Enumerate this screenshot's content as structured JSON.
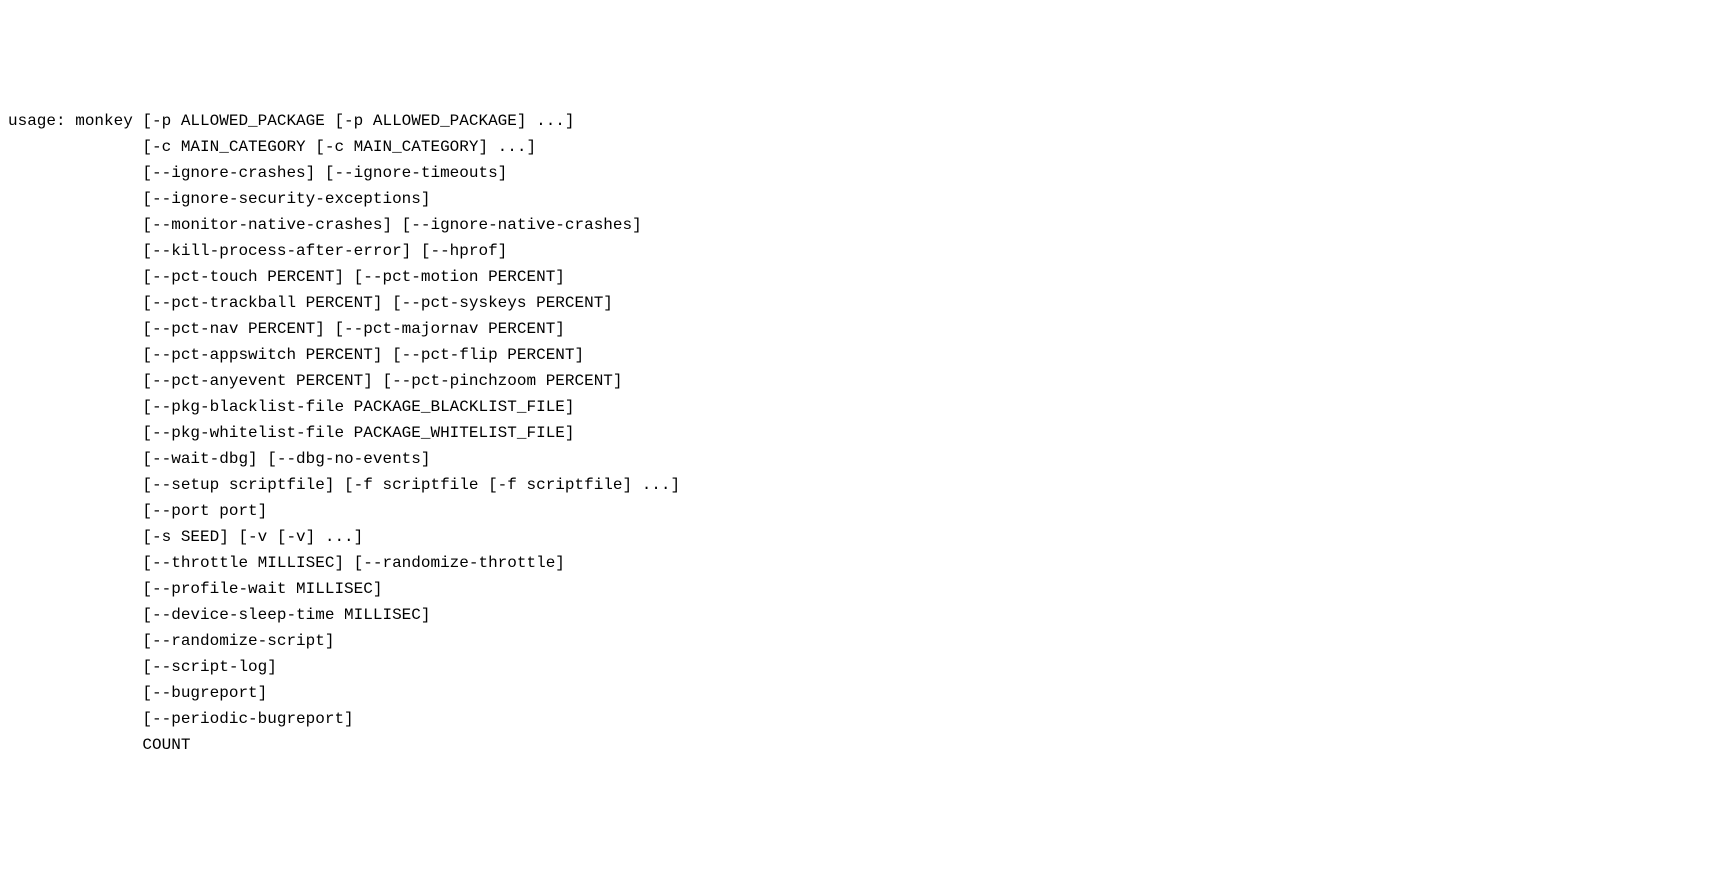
{
  "usage": {
    "lines": [
      "usage: monkey [-p ALLOWED_PACKAGE [-p ALLOWED_PACKAGE] ...]",
      "              [-c MAIN_CATEGORY [-c MAIN_CATEGORY] ...]",
      "              [--ignore-crashes] [--ignore-timeouts]",
      "              [--ignore-security-exceptions]",
      "              [--monitor-native-crashes] [--ignore-native-crashes]",
      "              [--kill-process-after-error] [--hprof]",
      "              [--pct-touch PERCENT] [--pct-motion PERCENT]",
      "              [--pct-trackball PERCENT] [--pct-syskeys PERCENT]",
      "              [--pct-nav PERCENT] [--pct-majornav PERCENT]",
      "              [--pct-appswitch PERCENT] [--pct-flip PERCENT]",
      "              [--pct-anyevent PERCENT] [--pct-pinchzoom PERCENT]",
      "              [--pkg-blacklist-file PACKAGE_BLACKLIST_FILE]",
      "              [--pkg-whitelist-file PACKAGE_WHITELIST_FILE]",
      "              [--wait-dbg] [--dbg-no-events]",
      "              [--setup scriptfile] [-f scriptfile [-f scriptfile] ...]",
      "              [--port port]",
      "              [-s SEED] [-v [-v] ...]",
      "              [--throttle MILLISEC] [--randomize-throttle]",
      "              [--profile-wait MILLISEC]",
      "              [--device-sleep-time MILLISEC]",
      "              [--randomize-script]",
      "              [--script-log]",
      "              [--bugreport]",
      "              [--periodic-bugreport]",
      "              COUNT"
    ]
  }
}
